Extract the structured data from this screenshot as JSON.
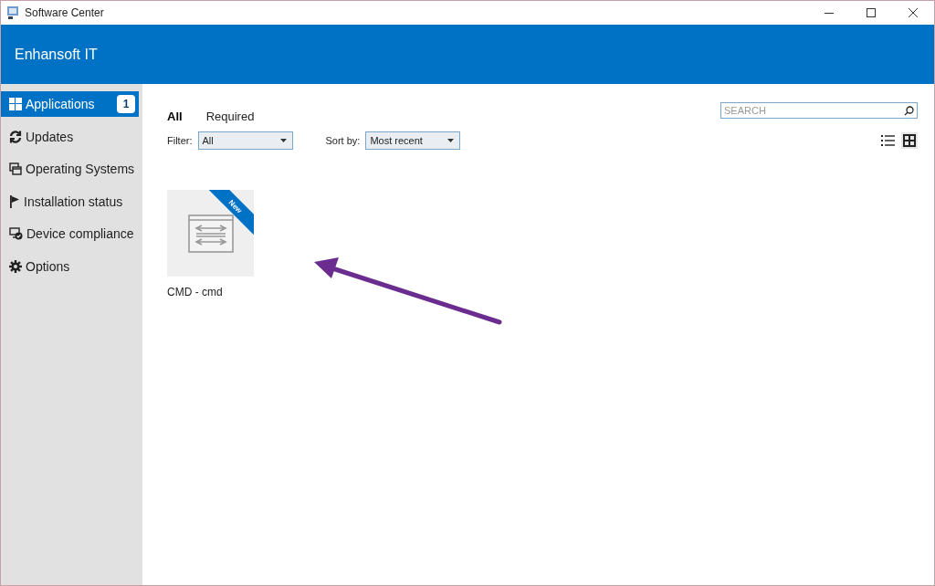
{
  "window": {
    "title": "Software Center"
  },
  "header": {
    "title": "Enhansoft IT"
  },
  "sidebar": {
    "items": [
      {
        "label": "Applications",
        "selected": true,
        "badge": "1"
      },
      {
        "label": "Updates",
        "selected": false
      },
      {
        "label": "Operating Systems",
        "selected": false
      },
      {
        "label": "Installation status",
        "selected": false
      },
      {
        "label": "Device compliance",
        "selected": false
      },
      {
        "label": "Options",
        "selected": false
      }
    ]
  },
  "tabs": [
    {
      "label": "All",
      "selected": true
    },
    {
      "label": "Required",
      "selected": false
    }
  ],
  "filter": {
    "label": "Filter:",
    "value": "All"
  },
  "sort": {
    "label": "Sort by:",
    "value": "Most recent"
  },
  "search": {
    "placeholder": "SEARCH"
  },
  "views": [
    {
      "kind": "list",
      "selected": false
    },
    {
      "kind": "grid",
      "selected": true
    }
  ],
  "apps": [
    {
      "name": "CMD - cmd",
      "ribbon": "New"
    }
  ]
}
